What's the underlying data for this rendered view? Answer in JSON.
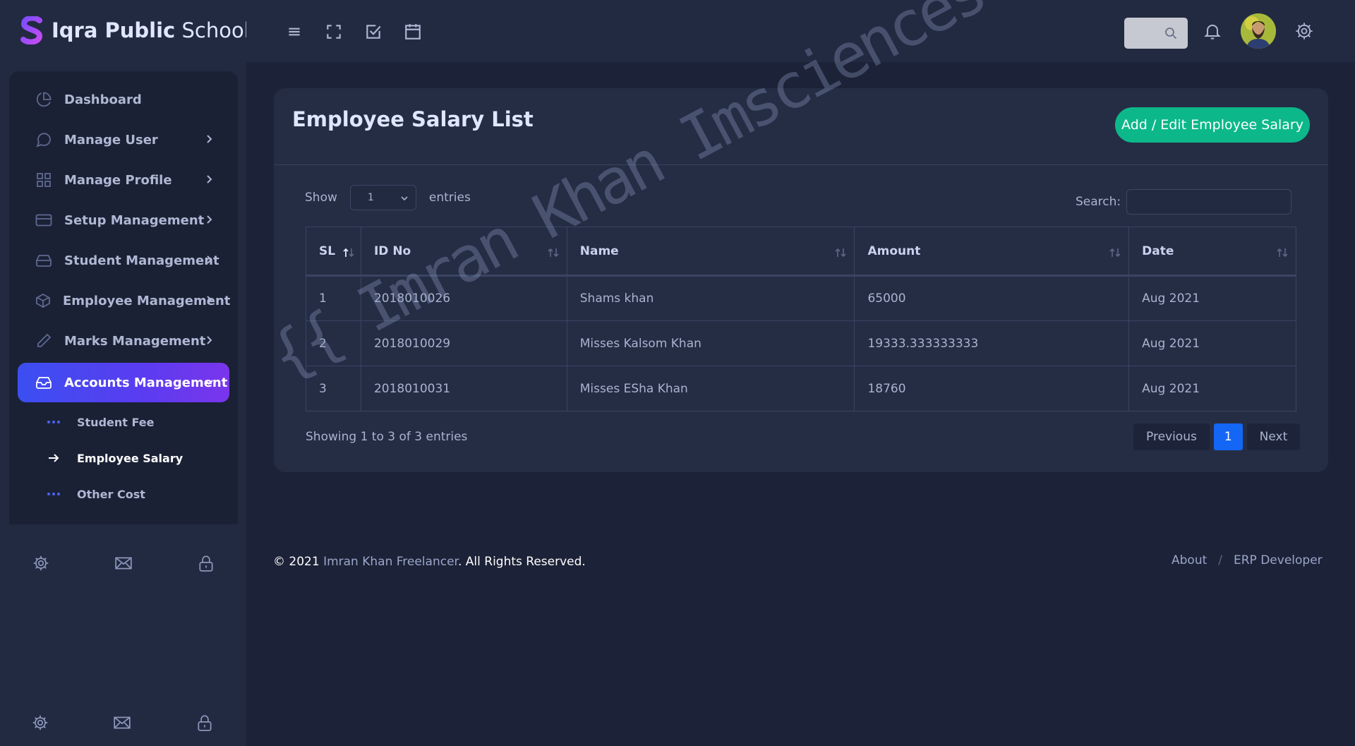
{
  "brand": {
    "name_bold": "Iqra Public",
    "name_rest": "School"
  },
  "sidebar": {
    "items": [
      {
        "label": "Dashboard",
        "icon": "pie-chart-icon"
      },
      {
        "label": "Manage User",
        "icon": "chat-bubble-icon"
      },
      {
        "label": "Manage Profile",
        "icon": "grid-icon"
      },
      {
        "label": "Setup Management",
        "icon": "credit-card-icon"
      },
      {
        "label": "Student Management",
        "icon": "hard-drive-icon"
      },
      {
        "label": "Employee Management",
        "icon": "package-icon"
      },
      {
        "label": "Marks Management",
        "icon": "pencil-icon"
      },
      {
        "label": "Accounts Management",
        "icon": "inbox-icon",
        "active": true
      }
    ],
    "submenu": [
      {
        "label": "Student Fee"
      },
      {
        "label": "Employee Salary",
        "active": true
      },
      {
        "label": "Other Cost"
      }
    ]
  },
  "page": {
    "title": "Employee Salary List",
    "add_button": "Add / Edit Employee Salary"
  },
  "table": {
    "show_label": "Show",
    "entries_label": "entries",
    "length_value": "1",
    "search_label": "Search:",
    "columns": [
      "SL",
      "ID No",
      "Name",
      "Amount",
      "Date"
    ],
    "rows": [
      [
        "1",
        "2018010026",
        "Shams khan",
        "65000",
        "Aug 2021"
      ],
      [
        "2",
        "2018010029",
        "Misses Kalsom Khan",
        "19333.333333333",
        "Aug 2021"
      ],
      [
        "3",
        "2018010031",
        "Misses ESha Khan",
        "18760",
        "Aug 2021"
      ]
    ],
    "info": "Showing 1 to 3 of 3 entries",
    "pagination": {
      "previous": "Previous",
      "current": "1",
      "next": "Next"
    }
  },
  "watermark": "{{ Imran Khan Imsciences }}",
  "footer": {
    "copyright_prefix": "© 2021",
    "copyright_link": "Imran Khan Freelancer",
    "copyright_suffix": ". All Rights Reserved.",
    "links": [
      "About",
      "ERP Developer"
    ],
    "separator": "/"
  },
  "colors": {
    "background": "#1c2237",
    "panel": "#222a41",
    "card": "#252d45",
    "accent": "#4a3ff0",
    "success": "#0cb88a",
    "primary": "#1466f5"
  }
}
